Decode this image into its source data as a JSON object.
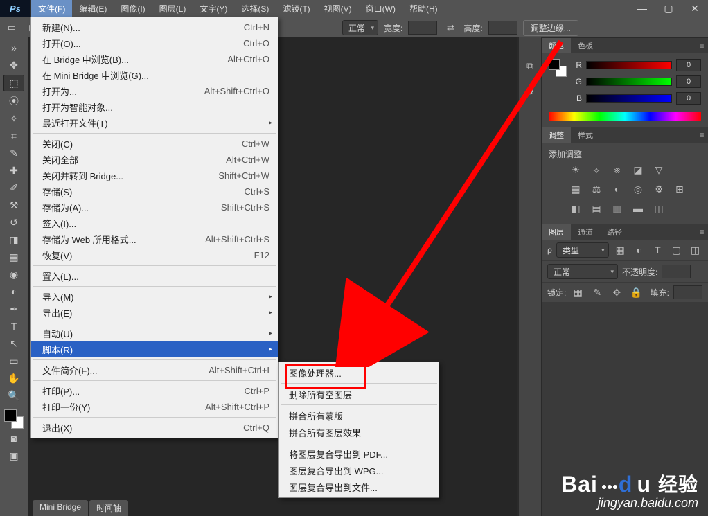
{
  "app_icon": "Ps",
  "menubar": [
    "文件(F)",
    "编辑(E)",
    "图像(I)",
    "图层(L)",
    "文字(Y)",
    "选择(S)",
    "滤镜(T)",
    "视图(V)",
    "窗口(W)",
    "帮助(H)"
  ],
  "active_menu_index": 0,
  "options_bar": {
    "marquee_hint": "矩形选框",
    "mode_label": "正常",
    "width_label": "宽度:",
    "height_label": "高度:",
    "refine_edge": "调整边缘..."
  },
  "file_menu": {
    "new": {
      "label": "新建(N)...",
      "shortcut": "Ctrl+N"
    },
    "open": {
      "label": "打开(O)...",
      "shortcut": "Ctrl+O"
    },
    "browse_bridge": {
      "label": "在 Bridge 中浏览(B)...",
      "shortcut": "Alt+Ctrl+O"
    },
    "browse_mini": {
      "label": "在 Mini Bridge 中浏览(G)..."
    },
    "open_as": {
      "label": "打开为...",
      "shortcut": "Alt+Shift+Ctrl+O"
    },
    "open_smart": {
      "label": "打开为智能对象..."
    },
    "open_recent": {
      "label": "最近打开文件(T)"
    },
    "close": {
      "label": "关闭(C)",
      "shortcut": "Ctrl+W"
    },
    "close_all": {
      "label": "关闭全部",
      "shortcut": "Alt+Ctrl+W"
    },
    "close_goto_bridge": {
      "label": "关闭并转到 Bridge...",
      "shortcut": "Shift+Ctrl+W"
    },
    "save": {
      "label": "存储(S)",
      "shortcut": "Ctrl+S"
    },
    "save_as": {
      "label": "存储为(A)...",
      "shortcut": "Shift+Ctrl+S"
    },
    "checkin": {
      "label": "签入(I)..."
    },
    "save_for_web": {
      "label": "存储为 Web 所用格式...",
      "shortcut": "Alt+Shift+Ctrl+S"
    },
    "revert": {
      "label": "恢复(V)",
      "shortcut": "F12"
    },
    "place": {
      "label": "置入(L)..."
    },
    "import": {
      "label": "导入(M)"
    },
    "export": {
      "label": "导出(E)"
    },
    "automate": {
      "label": "自动(U)"
    },
    "scripts": {
      "label": "脚本(R)"
    },
    "file_info": {
      "label": "文件简介(F)...",
      "shortcut": "Alt+Shift+Ctrl+I"
    },
    "print": {
      "label": "打印(P)...",
      "shortcut": "Ctrl+P"
    },
    "print_one": {
      "label": "打印一份(Y)",
      "shortcut": "Alt+Shift+Ctrl+P"
    },
    "exit": {
      "label": "退出(X)",
      "shortcut": "Ctrl+Q"
    }
  },
  "scripts_menu": {
    "image_processor": "图像处理器...",
    "delete_empty_layers": "删除所有空图层",
    "flatten_masks": "拼合所有蒙版",
    "flatten_layer_fx": "拼合所有图层效果",
    "export_comps_pdf": "将图层复合导出到 PDF...",
    "export_comps_wpg": "图层复合导出到 WPG...",
    "export_comps_files": "图层复合导出到文件..."
  },
  "doc_tabs": [
    "Mini Bridge",
    "时间轴"
  ],
  "panels": {
    "color": {
      "tabs": [
        "颜色",
        "色板"
      ],
      "r": "R",
      "g": "G",
      "b": "B",
      "r_val": "0",
      "g_val": "0",
      "b_val": "0"
    },
    "adjustments": {
      "tabs": [
        "调整",
        "样式"
      ],
      "add_label": "添加调整"
    },
    "layers": {
      "tabs": [
        "图层",
        "通道",
        "路径"
      ],
      "filter_label": "类型",
      "blend_mode": "正常",
      "opacity_label": "不透明度:",
      "lock_label": "锁定:",
      "fill_label": "填充:"
    }
  },
  "watermark": {
    "brand_pre": "Bai",
    "brand_mid": "d",
    "brand_post": "u",
    "cn": "经验",
    "url": "jingyan.baidu.com"
  }
}
